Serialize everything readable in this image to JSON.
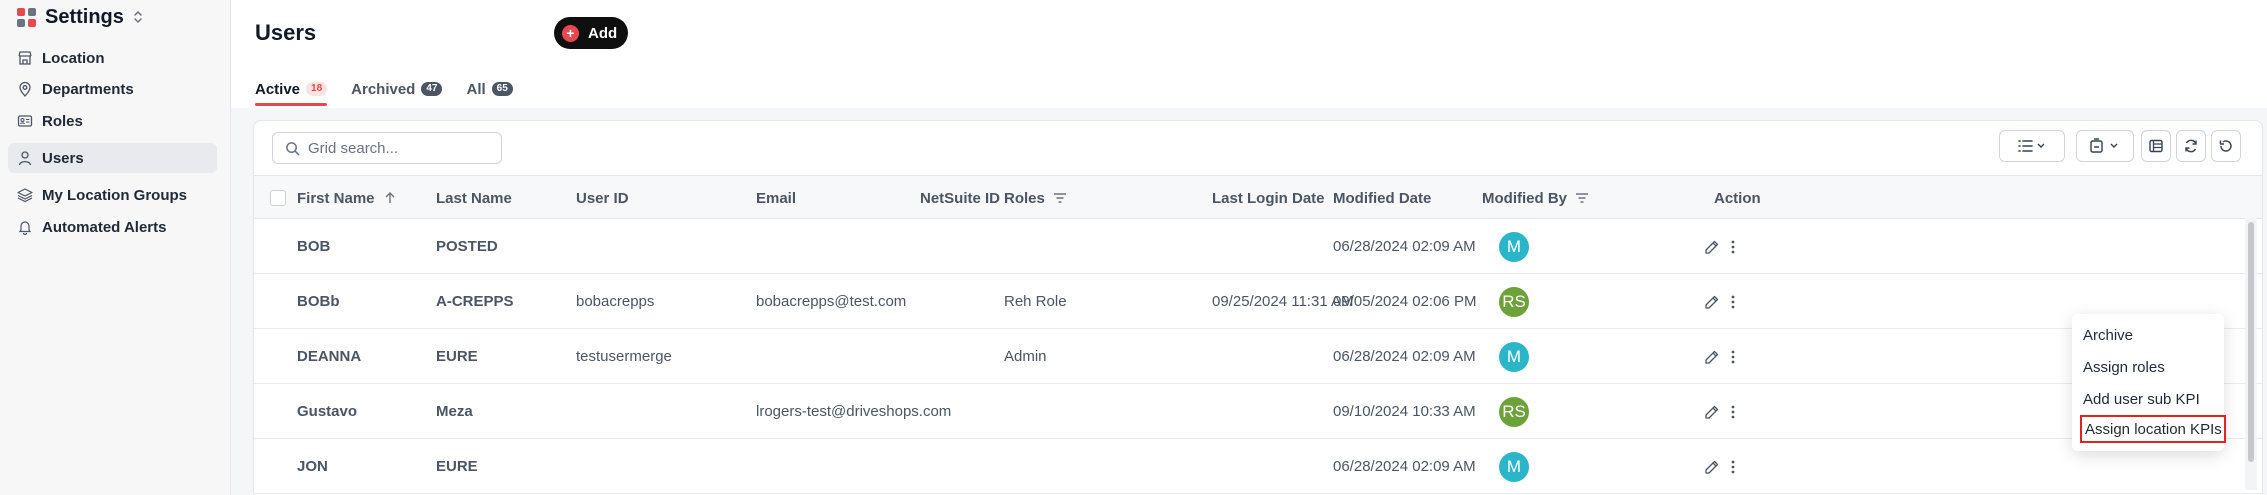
{
  "sidebar": {
    "title": "Settings",
    "items": [
      {
        "label": "Location",
        "icon": "store-icon"
      },
      {
        "label": "Departments",
        "icon": "map-pin-icon"
      },
      {
        "label": "Roles",
        "icon": "id-card-icon"
      },
      {
        "label": "Users",
        "icon": "user-icon",
        "active": true
      },
      {
        "label": "My Location Groups",
        "icon": "layers-icon"
      },
      {
        "label": "Automated Alerts",
        "icon": "bell-icon"
      }
    ]
  },
  "header": {
    "title": "Users",
    "add_label": "Add"
  },
  "tabs": [
    {
      "label": "Active",
      "count": "18",
      "active": true
    },
    {
      "label": "Archived",
      "count": "47"
    },
    {
      "label": "All",
      "count": "65"
    }
  ],
  "search": {
    "placeholder": "Grid search..."
  },
  "table": {
    "columns": [
      "First Name",
      "Last Name",
      "User ID",
      "Email",
      "NetSuite ID",
      "Roles",
      "Last Login Date",
      "Modified Date",
      "Modified By",
      "Action"
    ],
    "rows": [
      {
        "first": "BOB",
        "last": "POSTED",
        "user_id": "",
        "email": "",
        "netsuite": "",
        "roles": "",
        "last_login": "",
        "modified": "06/28/2024 02:09 AM",
        "by": "M",
        "by_color": "#2bb5c8"
      },
      {
        "first": "BOBb",
        "last": "A-CREPPS",
        "user_id": "bobacrepps",
        "email": "bobacrepps@test.com",
        "netsuite": "",
        "roles": "Reh Role",
        "last_login": "09/25/2024 11:31 AM",
        "modified": "09/05/2024 02:06 PM",
        "by": "RS",
        "by_color": "#6ba33a"
      },
      {
        "first": "DEANNA",
        "last": "EURE",
        "user_id": "testusermerge",
        "email": "",
        "netsuite": "",
        "roles": "Admin",
        "last_login": "",
        "modified": "06/28/2024 02:09 AM",
        "by": "M",
        "by_color": "#2bb5c8"
      },
      {
        "first": "Gustavo",
        "last": "Meza",
        "user_id": "",
        "email": "lrogers-test@driveshops.com",
        "netsuite": "",
        "roles": "",
        "last_login": "",
        "modified": "09/10/2024 10:33 AM",
        "by": "RS",
        "by_color": "#6ba33a"
      },
      {
        "first": "JON",
        "last": "EURE",
        "user_id": "",
        "email": "",
        "netsuite": "",
        "roles": "",
        "last_login": "",
        "modified": "06/28/2024 02:09 AM",
        "by": "M",
        "by_color": "#2bb5c8"
      }
    ]
  },
  "menu": {
    "items": [
      "Archive",
      "Assign roles",
      "Add user sub KPI",
      "Assign location KPIs"
    ]
  },
  "colors": {
    "accent": "#e5484d",
    "highlight_border": "#e02424"
  }
}
